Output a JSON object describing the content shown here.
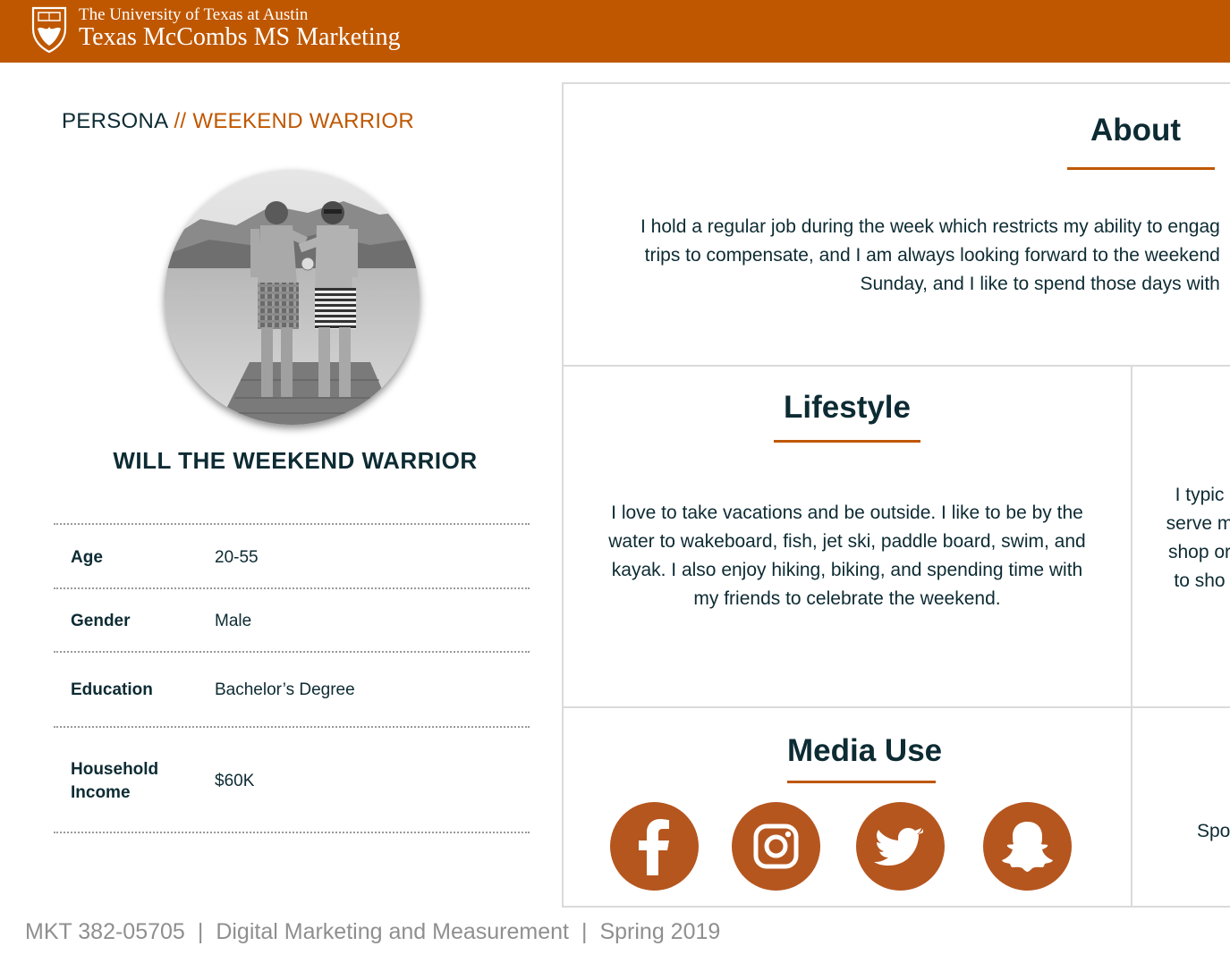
{
  "header": {
    "university": "The University of Texas at Austin",
    "program": "Texas McCombs MS Marketing"
  },
  "persona": {
    "label": "PERSONA",
    "tag": "// WEEKEND WARRIOR",
    "name": "WILL THE WEEKEND WARRIOR",
    "details": [
      {
        "key": "Age",
        "value": "20-55"
      },
      {
        "key": "Gender",
        "value": "Male"
      },
      {
        "key": "Education",
        "value": "Bachelor’s Degree"
      },
      {
        "key_lines": [
          "Household",
          "Income"
        ],
        "value": "$60K"
      }
    ]
  },
  "about": {
    "title": "About",
    "lines": [
      "I hold a regular job during the week which restricts my ability to engag",
      "trips to compensate, and I am always looking forward to the weekend",
      "Sunday, and I like to spend those days with"
    ]
  },
  "lifestyle": {
    "title": "Lifestyle",
    "lines": [
      "I love to take vacations and be outside. I like to be by the",
      "water to wakeboard, fish, jet ski, paddle board, swim, and",
      "kayak. I also enjoy hiking, biking, and spending time with",
      "my friends to celebrate the weekend."
    ]
  },
  "right_panel_1": {
    "lines": [
      "I typic",
      "serve m",
      "shop or",
      "to sho"
    ]
  },
  "media_use": {
    "title": "Media Use",
    "icons": [
      "facebook-icon",
      "instagram-icon",
      "twitter-icon",
      "snapchat-icon"
    ],
    "accent_color": "#b5561f"
  },
  "right_panel_2": {
    "text": "Spo"
  },
  "footer": {
    "course": "MKT 382-05705",
    "separator": "|",
    "course_name": "Digital Marketing and Measurement",
    "term": "Spring 2019"
  },
  "colors": {
    "brand_orange": "#bf5700",
    "navy_text": "#0d2b33",
    "footer_gray": "#8f8f8f"
  }
}
